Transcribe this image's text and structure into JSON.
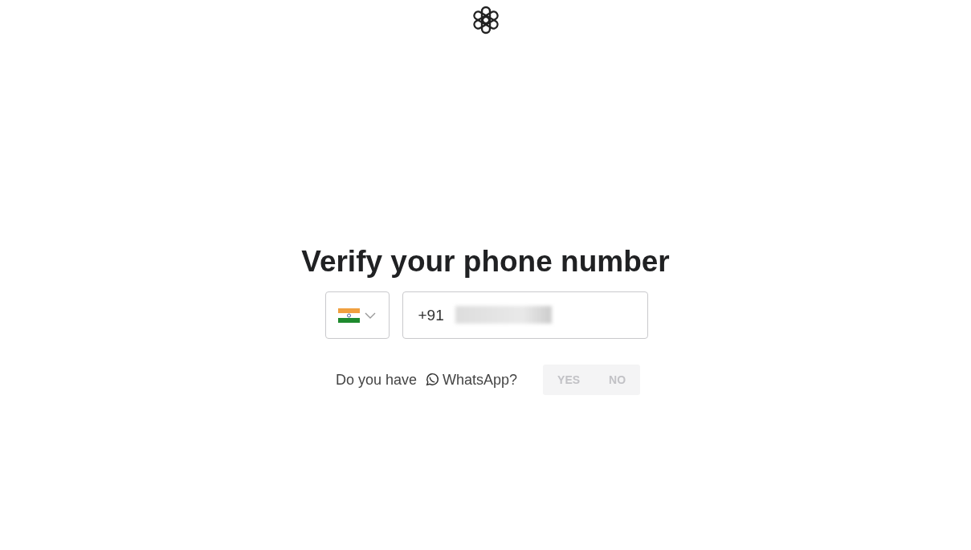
{
  "title": "Verify your phone number",
  "phone": {
    "value": "+91"
  },
  "whatsapp": {
    "prefix": "Do you have",
    "label": "WhatsApp?",
    "options": [
      {
        "label": "YES",
        "selected": false
      },
      {
        "label": "NO",
        "selected": false
      }
    ]
  }
}
